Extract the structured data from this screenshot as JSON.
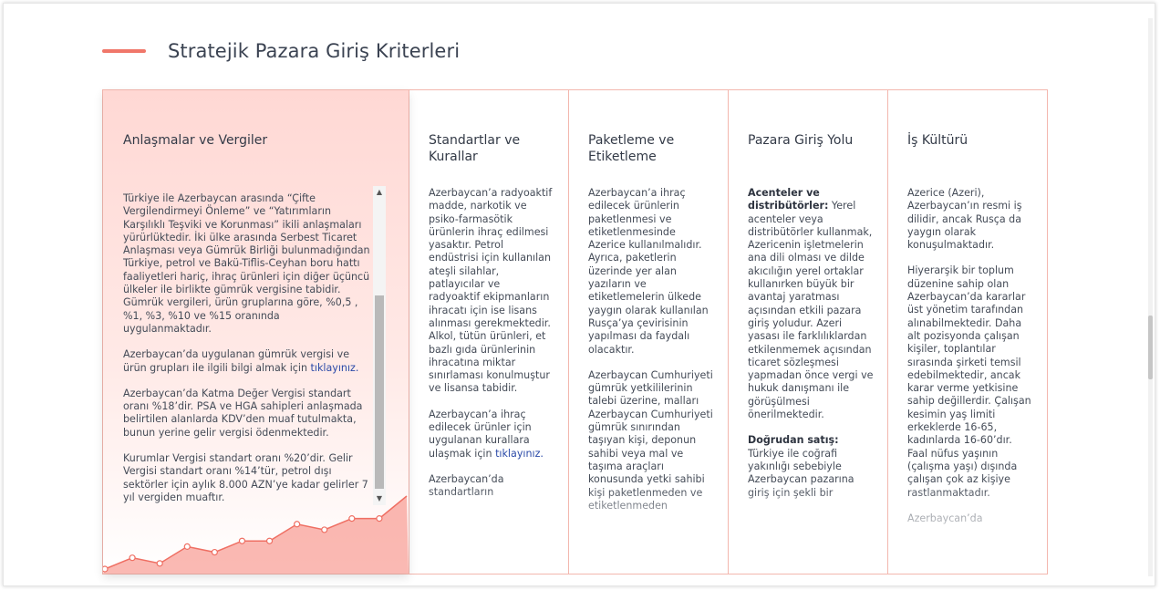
{
  "page": {
    "title": "Stratejik Pazara Giriş Kriterleri"
  },
  "colors": {
    "accent": "#f0776a",
    "border": "#f3b7ae",
    "link": "#2b4aa8"
  },
  "cards": [
    {
      "title": "Anlaşmalar ve Vergiler",
      "paragraphs": [
        {
          "text": "Türkiye ile Azerbaycan arasında “Çifte Vergilendirmeyi Önleme” ve “Yatırımların Karşılıklı Teşviki ve Korunması” ikili anlaşmaları yürürlüktedir. İki ülke arasında Serbest Ticaret Anlaşması veya Gümrük Birliği bulunmadığından Türkiye, petrol ve Bakü-Tiflis-Ceyhan boru hattı faaliyetleri hariç, ihraç ürünleri için diğer üçüncü ülkeler ile birlikte gümrük vergisine tabidir. Gümrük vergileri, ürün gruplarına göre, %0,5 , %1, %3, %10 ve %15 oranında uygulanmaktadır."
        },
        {
          "text": "Azerbaycan’da uygulanan gümrük vergisi ve ürün grupları ile ilgili bilgi almak için ",
          "link": "tıklayınız."
        },
        {
          "text": "Azerbaycan’da Katma Değer Vergisi standart oranı %18’dir. PSA ve HGA sahipleri anlaşmada belirtilen alanlarda KDV’den muaf tutulmakta, bunun yerine gelir vergisi ödenmektedir."
        },
        {
          "text": "Kurumlar Vergisi standart oranı %20’dir. Gelir Vergisi standart oranı %14’tür, petrol dışı sektörler için aylık 8.000 AZN’ye kadar gelirler 7 yıl vergiden muaftır."
        }
      ]
    },
    {
      "title": "Standartlar ve Kurallar",
      "paragraphs": [
        {
          "text": "Azerbaycan’a radyoaktif madde, narkotik ve psiko-farmasötik ürünlerin ihraç edilmesi yasaktır. Petrol endüstrisi için kullanılan ateşli silahlar, patlayıcılar ve radyoaktif ekipmanların ihracatı için ise lisans alınması gerekmektedir. Alkol, tütün ürünleri, et bazlı gıda ürünlerinin ihracatına miktar sınırlaması konulmuştur ve lisansa tabidir."
        },
        {
          "text": "Azerbaycan’a ihraç edilecek ürünler için uygulanan kurallara ulaşmak için ",
          "link": "tıklayınız."
        },
        {
          "text": "Azerbaycan’da standartların"
        }
      ]
    },
    {
      "title": "Paketleme ve Etiketleme",
      "paragraphs": [
        {
          "text": "Azerbaycan’a ihraç edilecek ürünlerin paketlenmesi ve etiketlenmesinde Azerice kullanılmalıdır. Ayrıca, paketlerin üzerinde yer alan yazıların ve etiketlemelerin ülkede yaygın olarak kullanılan Rusça’ya çevirisinin yapılması da faydalı olacaktır."
        },
        {
          "text": "Azerbaycan Cumhuriyeti gümrük yetkililerinin talebi üzerine, malları Azerbaycan Cumhuriyeti gümrük sınırından taşıyan kişi, deponun sahibi veya mal ve taşıma araçları konusunda yetki sahibi kişi paketlenmeden ve etiketlenmeden"
        }
      ]
    },
    {
      "title": "Pazara Giriş Yolu",
      "paragraphs": [
        {
          "bold": "Acenteler ve distribütörler:",
          "text": " Yerel acenteler veya distribütörler kullanmak, Azericenin işletmelerin ana dili olması ve dilde akıcılığın yerel ortaklar kullanırken büyük bir avantaj yaratması açısından etkili pazara giriş yoludur. Azeri yasası ile farklılıklardan etkilenmemek açısından ticaret sözleşmesi yapmadan önce vergi ve hukuk danışmanı ile görüşülmesi önerilmektedir."
        },
        {
          "bold": "Doğrudan satış:",
          "text": " Türkiye ile coğrafi yakınlığı sebebiyle Azerbaycan pazarına giriş için şekli bir"
        }
      ]
    },
    {
      "title": "İş Kültürü",
      "paragraphs": [
        {
          "text": "Azerice (Azeri), Azerbaycan’ın resmi iş dilidir, ancak Rusça da yaygın olarak konuşulmaktadır."
        },
        {
          "text": "Hiyerarşik bir toplum düzenine sahip olan Azerbaycan’da kararlar üst yönetim tarafından alınabilmektedir. Daha alt pozisyonda çalışan kişiler, toplantılar sırasında şirketi temsil edebilmektedir, ancak karar verme yetkisine sahip değillerdir. Çalışan kesimin yaş limiti erkeklerde 16-65, kadınlarda 16-60’dır. Faal nüfus yaşının (çalışma yaşı) dışında çalışan çok az kişiye rastlanmaktadır."
        },
        {
          "text": "Azerbaycan’da"
        }
      ]
    }
  ],
  "decor_chart": {
    "values": [
      1,
      3,
      2,
      5,
      4,
      6,
      6,
      9,
      8,
      10,
      10,
      14
    ]
  }
}
